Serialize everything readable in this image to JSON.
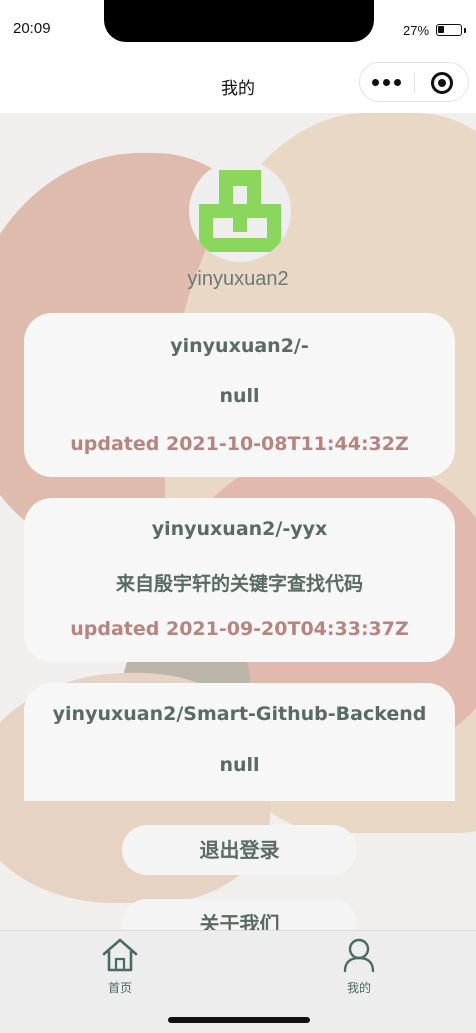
{
  "status_bar": {
    "time": "20:09",
    "battery_percent": "27%",
    "battery_level": 0.27
  },
  "nav": {
    "title": "我的",
    "more_icon": "more-dots-icon",
    "close_icon": "target-icon"
  },
  "profile": {
    "username": "yinyuxuan2",
    "avatar_icon": "identicon-avatar"
  },
  "repos": [
    {
      "name": "yinyuxuan2/-",
      "description": "null",
      "updated": "updated 2021-10-08T11:44:32Z"
    },
    {
      "name": "yinyuxuan2/-yyx",
      "description": "来自殷宇轩的关键字查找代码",
      "updated": "updated 2021-09-20T04:33:37Z"
    },
    {
      "name": "yinyuxuan2/Smart-Github-Backend",
      "description": "null"
    }
  ],
  "buttons": {
    "logout": "退出登录",
    "about": "关于我们"
  },
  "tabbar": [
    {
      "label": "首页",
      "icon": "home-icon"
    },
    {
      "label": "我的",
      "icon": "user-icon"
    }
  ],
  "colors": {
    "accent_text": "#5a6b63",
    "updated_text": "#b58680",
    "avatar_green": "#8bd65c"
  }
}
